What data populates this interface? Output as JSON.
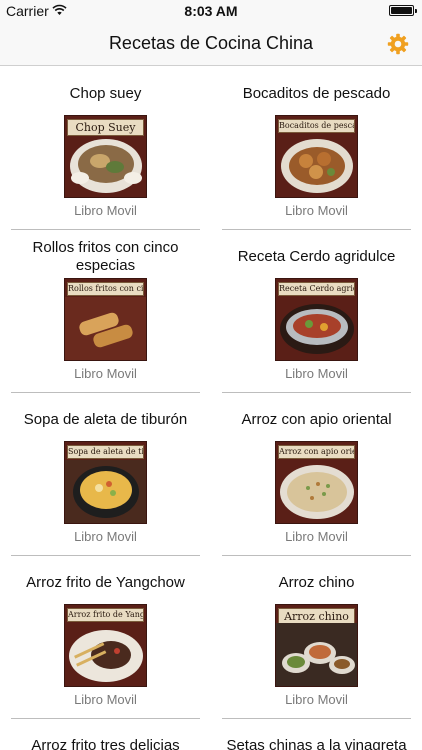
{
  "status": {
    "carrier": "Carrier",
    "time": "8:03 AM"
  },
  "nav": {
    "title": "Recetas de Cocina China",
    "settings_icon": "gear-icon",
    "accent": "#f0a020"
  },
  "recipes": [
    {
      "title": "Chop suey",
      "thumb_label": "Chop Suey",
      "subtitle": "Libro Movil"
    },
    {
      "title": "Bocaditos de pescado",
      "thumb_label": "Bocaditos de pescado",
      "subtitle": "Libro Movil"
    },
    {
      "title": "Rollos fritos con cinco especias",
      "thumb_label": "Rollos fritos con cinco especias",
      "subtitle": "Libro Movil"
    },
    {
      "title": "Receta Cerdo agridulce",
      "thumb_label": "Receta Cerdo agridulce",
      "subtitle": "Libro Movil"
    },
    {
      "title": "Sopa de aleta de tiburón",
      "thumb_label": "Sopa de aleta de tiburón",
      "subtitle": "Libro Movil"
    },
    {
      "title": "Arroz con apio oriental",
      "thumb_label": "Arroz con apio oriental",
      "subtitle": "Libro Movil"
    },
    {
      "title": "Arroz frito de Yangchow",
      "thumb_label": "Arroz frito de Yangchow",
      "subtitle": "Libro Movil"
    },
    {
      "title": "Arroz chino",
      "thumb_label": "Arroz chino",
      "subtitle": "Libro Movil"
    },
    {
      "title": "Arroz frito tres delicias",
      "thumb_label": "",
      "subtitle": ""
    },
    {
      "title": "Setas chinas a la vinagreta",
      "thumb_label": "",
      "subtitle": ""
    }
  ]
}
